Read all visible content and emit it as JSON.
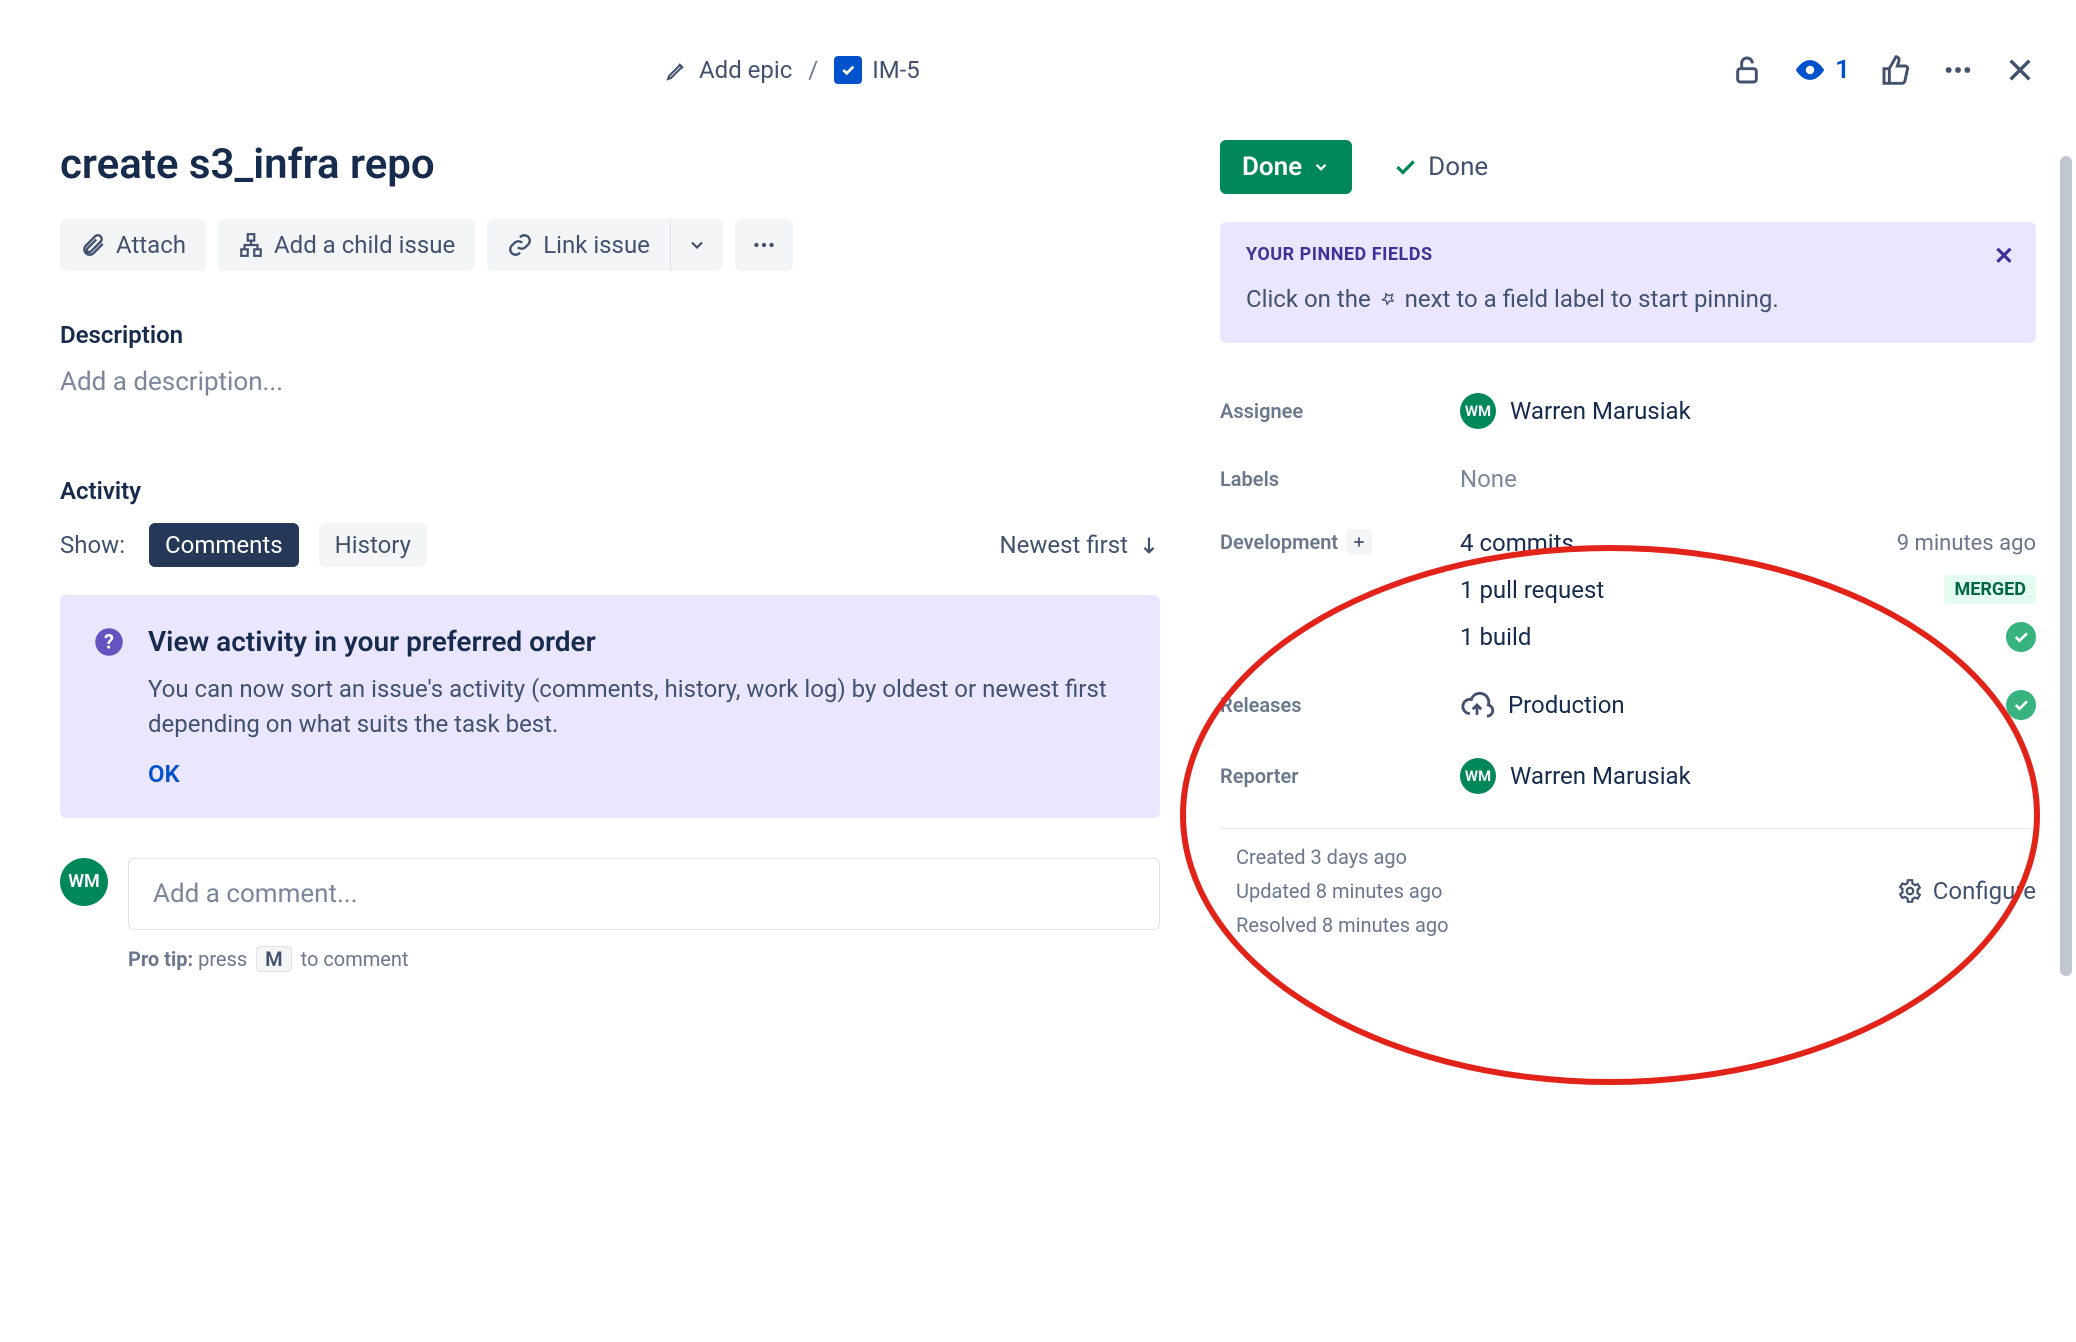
{
  "breadcrumb": {
    "add_epic": "Add epic",
    "issue_key": "IM-5"
  },
  "header": {
    "watch_count": "1"
  },
  "issue": {
    "title": "create s3_infra repo"
  },
  "actions": {
    "attach": "Attach",
    "child_issue": "Add a child issue",
    "link_issue": "Link issue"
  },
  "description": {
    "label": "Description",
    "placeholder": "Add a description..."
  },
  "activity": {
    "label": "Activity",
    "show_label": "Show:",
    "tab_comments": "Comments",
    "tab_history": "History",
    "sort_label": "Newest first"
  },
  "banner": {
    "title": "View activity in your preferred order",
    "body": "You can now sort an issue's activity (comments, history, work log) by oldest or newest first depending on what suits the task best.",
    "ok": "OK"
  },
  "comment": {
    "avatar_initials": "WM",
    "placeholder": "Add a comment...",
    "protip_prefix": "Pro tip:",
    "protip_press": "press",
    "protip_key": "M",
    "protip_suffix": "to comment"
  },
  "status": {
    "button": "Done",
    "resolution": "Done"
  },
  "pinned": {
    "title": "YOUR PINNED FIELDS",
    "body_pre": "Click on the",
    "body_post": "next to a field label to start pinning."
  },
  "fields": {
    "assignee_label": "Assignee",
    "assignee_value": "Warren Marusiak",
    "assignee_initials": "WM",
    "labels_label": "Labels",
    "labels_value": "None",
    "development_label": "Development",
    "dev_commits": "4 commits",
    "dev_commits_time": "9 minutes ago",
    "dev_pr": "1 pull request",
    "dev_pr_badge": "MERGED",
    "dev_build": "1 build",
    "releases_label": "Releases",
    "releases_value": "Production",
    "reporter_label": "Reporter",
    "reporter_value": "Warren Marusiak",
    "reporter_initials": "WM"
  },
  "meta": {
    "created": "Created 3 days ago",
    "updated": "Updated 8 minutes ago",
    "resolved": "Resolved 8 minutes ago",
    "configure": "Configure"
  }
}
